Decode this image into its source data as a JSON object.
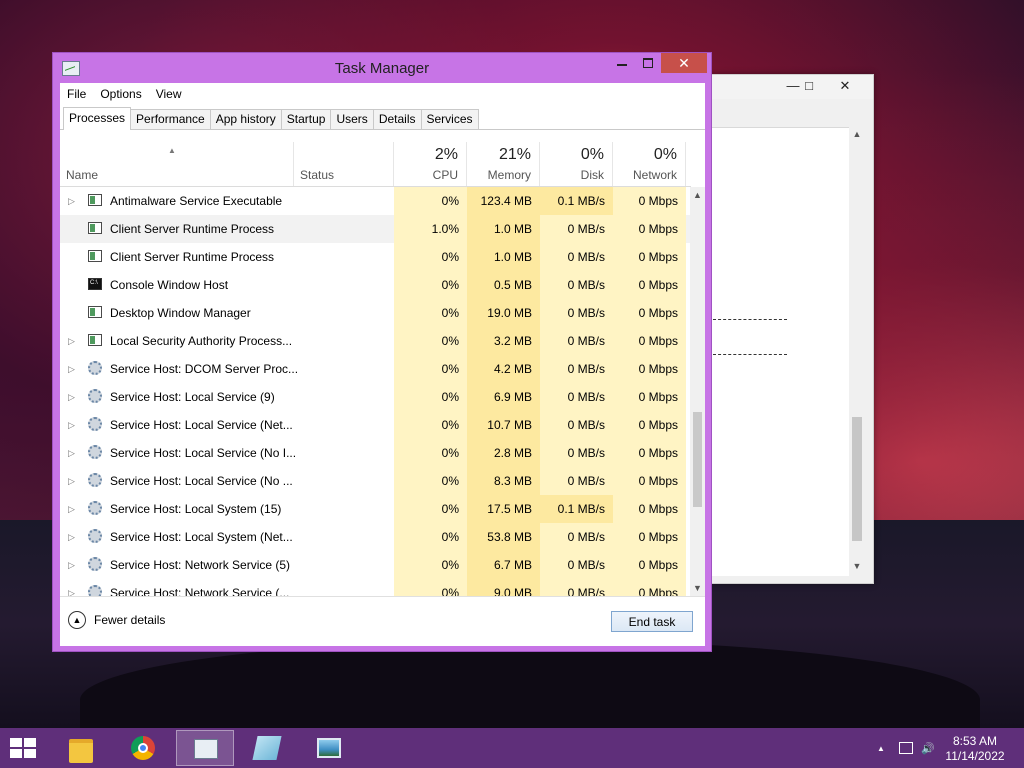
{
  "task_manager": {
    "title": "Task Manager",
    "menu": [
      "File",
      "Options",
      "View"
    ],
    "tabs": [
      "Processes",
      "Performance",
      "App history",
      "Startup",
      "Users",
      "Details",
      "Services"
    ],
    "active_tab": "Processes",
    "columns": {
      "name": "Name",
      "status": "Status",
      "cpu": {
        "pct": "2%",
        "label": "CPU"
      },
      "memory": {
        "pct": "21%",
        "label": "Memory"
      },
      "disk": {
        "pct": "0%",
        "label": "Disk"
      },
      "network": {
        "pct": "0%",
        "label": "Network"
      }
    },
    "rows": [
      {
        "name": "Antimalware Service Executable",
        "icon": "window-icon",
        "expandable": true,
        "cpu": "0%",
        "mem": "123.4 MB",
        "disk": "0.1 MB/s",
        "net": "0 Mbps"
      },
      {
        "name": "Client Server Runtime Process",
        "icon": "window-icon",
        "expandable": false,
        "cpu": "1.0%",
        "mem": "1.0 MB",
        "disk": "0 MB/s",
        "net": "0 Mbps"
      },
      {
        "name": "Client Server Runtime Process",
        "icon": "window-icon",
        "expandable": false,
        "cpu": "0%",
        "mem": "1.0 MB",
        "disk": "0 MB/s",
        "net": "0 Mbps"
      },
      {
        "name": "Console Window Host",
        "icon": "console-icon",
        "expandable": false,
        "cpu": "0%",
        "mem": "0.5 MB",
        "disk": "0 MB/s",
        "net": "0 Mbps"
      },
      {
        "name": "Desktop Window Manager",
        "icon": "window-icon",
        "expandable": false,
        "cpu": "0%",
        "mem": "19.0 MB",
        "disk": "0 MB/s",
        "net": "0 Mbps"
      },
      {
        "name": "Local Security Authority Process...",
        "icon": "window-icon",
        "expandable": true,
        "cpu": "0%",
        "mem": "3.2 MB",
        "disk": "0 MB/s",
        "net": "0 Mbps"
      },
      {
        "name": "Service Host: DCOM Server Proc...",
        "icon": "gear-icon",
        "expandable": true,
        "cpu": "0%",
        "mem": "4.2 MB",
        "disk": "0 MB/s",
        "net": "0 Mbps"
      },
      {
        "name": "Service Host: Local Service (9)",
        "icon": "gear-icon",
        "expandable": true,
        "cpu": "0%",
        "mem": "6.9 MB",
        "disk": "0 MB/s",
        "net": "0 Mbps"
      },
      {
        "name": "Service Host: Local Service (Net...",
        "icon": "gear-icon",
        "expandable": true,
        "cpu": "0%",
        "mem": "10.7 MB",
        "disk": "0 MB/s",
        "net": "0 Mbps"
      },
      {
        "name": "Service Host: Local Service (No I...",
        "icon": "gear-icon",
        "expandable": true,
        "cpu": "0%",
        "mem": "2.8 MB",
        "disk": "0 MB/s",
        "net": "0 Mbps"
      },
      {
        "name": "Service Host: Local Service (No ...",
        "icon": "gear-icon",
        "expandable": true,
        "cpu": "0%",
        "mem": "8.3 MB",
        "disk": "0 MB/s",
        "net": "0 Mbps"
      },
      {
        "name": "Service Host: Local System (15)",
        "icon": "gear-icon",
        "expandable": true,
        "cpu": "0%",
        "mem": "17.5 MB",
        "disk": "0.1 MB/s",
        "net": "0 Mbps"
      },
      {
        "name": "Service Host: Local System (Net...",
        "icon": "gear-icon",
        "expandable": true,
        "cpu": "0%",
        "mem": "53.8 MB",
        "disk": "0 MB/s",
        "net": "0 Mbps"
      },
      {
        "name": "Service Host: Network Service (5)",
        "icon": "gear-icon",
        "expandable": true,
        "cpu": "0%",
        "mem": "6.7 MB",
        "disk": "0 MB/s",
        "net": "0 Mbps"
      },
      {
        "name": "Service Host: Network Service (...",
        "icon": "gear-icon",
        "expandable": true,
        "cpu": "0%",
        "mem": "9.0 MB",
        "disk": "0 MB/s",
        "net": "0 Mbps"
      }
    ],
    "footer": {
      "fewer_details": "Fewer details",
      "end_task": "End task"
    }
  },
  "taskbar": {
    "apps": [
      "file-explorer-icon",
      "chrome-icon",
      "task-manager-icon",
      "notepad-icon",
      "image-viewer-icon"
    ],
    "time": "8:53 AM",
    "date": "11/14/2022"
  },
  "colors": {
    "window_frame": "#c774e6",
    "close_button": "#c7504a",
    "taskbar": "#5f2f7a",
    "heat_light": "#fff4c4",
    "heat_medium": "#fde9a0"
  }
}
